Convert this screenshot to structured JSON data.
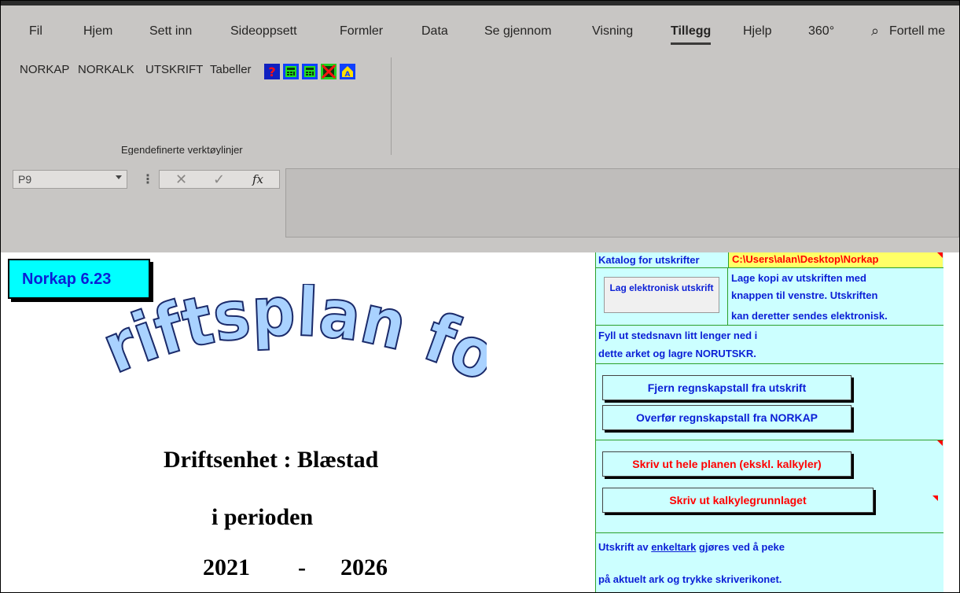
{
  "ribbon": {
    "tabs": [
      "Fil",
      "Hjem",
      "Sett inn",
      "Sideoppsett",
      "Formler",
      "Data",
      "Se gjennom",
      "Visning",
      "Tillegg",
      "Hjelp",
      "360°"
    ],
    "active_tab": "Tillegg",
    "tell_me": "Fortell me",
    "addins": [
      "NORKAP",
      "NORKALK",
      "UTSKRIFT",
      "Tabeller"
    ],
    "toolbar_icons": [
      "help-icon",
      "calculator-icon",
      "calculator-icon",
      "close-form-icon",
      "house-icon"
    ],
    "group_label": "Egendefinerte verktøylinjer"
  },
  "formula_bar": {
    "name_box": "P9",
    "cancel_glyph": "✕",
    "enter_glyph": "✓",
    "fx_label": "fx",
    "content": ""
  },
  "sheet": {
    "version_label": "Norkap 6.23",
    "wordart_title": "Driftsplan for",
    "unit_line": "Driftsenhet : Blæstad",
    "period_line": "i perioden",
    "year_from": "2021",
    "year_sep": "-",
    "year_to": "2026"
  },
  "panel": {
    "catalog_label": "Katalog for utskrifter",
    "catalog_path": "C:\\Users\\alan\\Desktop\\Norkap",
    "electronic_button": "Lag elektronisk utskrift",
    "electronic_desc_1": "Lage kopi av utskriften med",
    "electronic_desc_2": "knappen til venstre. Utskriften",
    "electronic_desc_3": "kan deretter sendes elektronisk.",
    "place_note_1": "Fyll ut stedsnavn litt lenger ned i",
    "place_note_2": "dette arket og lagre NORUTSKR.",
    "remove_button": "Fjern regnskapstall fra utskrift",
    "transfer_button": "Overfør regnskapstall fra NORKAP",
    "print_all_button": "Skriv ut hele planen (ekskl. kalkyler)",
    "print_calc_button": "Skriv ut kalkylegrunnlaget",
    "single_sheet_pre": "Utskrift av ",
    "single_sheet_link": "enkeltark",
    "single_sheet_post": " gjøres ved å peke",
    "single_sheet_2": "på aktuelt ark og trykke skriverikonet."
  },
  "colors": {
    "ribbon_bg": "#c8c6c4",
    "panel_bg": "#ccffff",
    "panel_text": "#0b1fd6",
    "print_text": "#ff0000",
    "path_bg": "#ffff66",
    "version_bg": "#00ffff",
    "wordart_fill": "#a9d2ff"
  }
}
